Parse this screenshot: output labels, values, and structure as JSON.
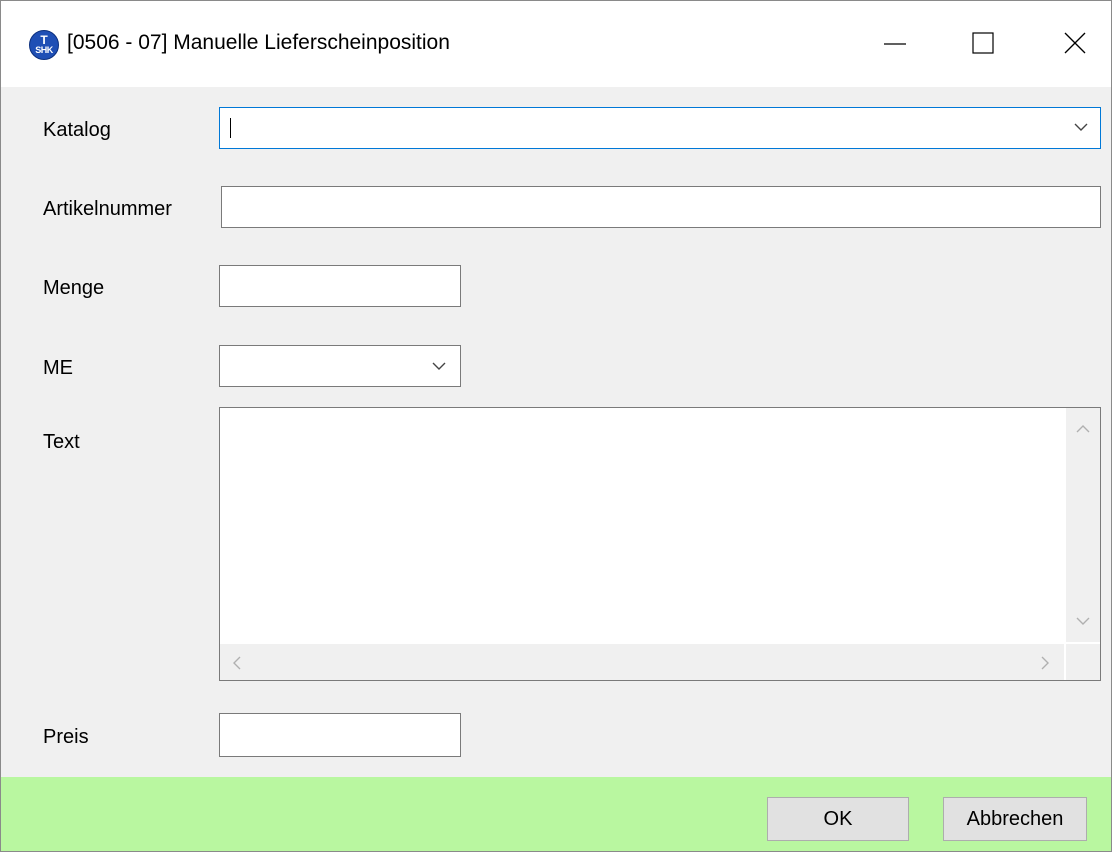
{
  "window": {
    "title": "[0506 - 07] Manuelle Lieferscheinposition",
    "icon_text_top": "T",
    "icon_text_bottom": "SHK"
  },
  "form": {
    "katalog_label": "Katalog",
    "katalog_value": "",
    "artikelnummer_label": "Artikelnummer",
    "artikelnummer_value": "",
    "menge_label": "Menge",
    "menge_value": "",
    "me_label": "ME",
    "me_value": "",
    "text_label": "Text",
    "text_value": "",
    "preis_label": "Preis",
    "preis_value": ""
  },
  "footer": {
    "ok_label": "OK",
    "cancel_label": "Abbrechen",
    "background": "#b9f7a0"
  },
  "colors": {
    "focus_border": "#0078d7",
    "field_border": "#7a7a7a"
  }
}
